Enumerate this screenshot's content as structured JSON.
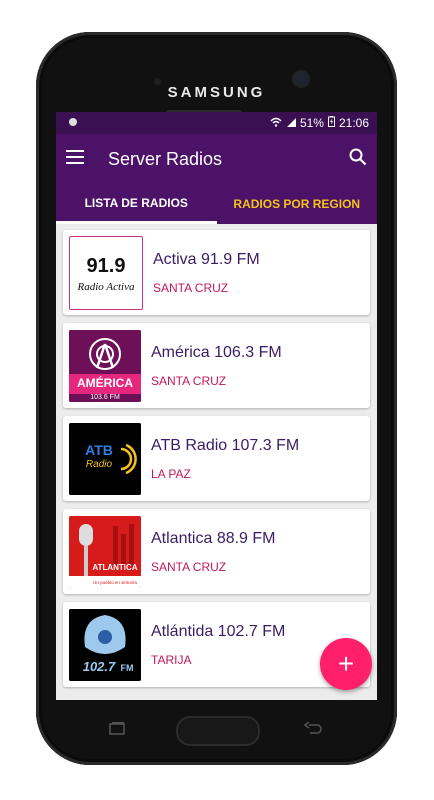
{
  "device": {
    "brand": "SAMSUNG"
  },
  "status": {
    "signal_text": "51%",
    "battery_icon": "battery-charging-icon",
    "time": "21:06"
  },
  "appbar": {
    "title": "Server Radios",
    "menu_icon": "hamburger-icon",
    "search_icon": "search-icon"
  },
  "tabs": [
    {
      "label": "LISTA DE RADIOS",
      "active": true
    },
    {
      "label": "RADIOS POR REGION",
      "active": false
    }
  ],
  "radios": [
    {
      "name": "Activa 91.9 FM",
      "city": "SANTA CRUZ",
      "logo": "activa-logo",
      "logo_text": "91.9",
      "logo_sub": "Radio Activa"
    },
    {
      "name": "América 106.3 FM",
      "city": "SANTA CRUZ",
      "logo": "america-logo",
      "logo_text": "AMÉRICA",
      "logo_sub": "103.6 FM"
    },
    {
      "name": "ATB Radio 107.3 FM",
      "city": "LA PAZ",
      "logo": "atb-logo",
      "logo_text": "ATB",
      "logo_sub": "Radio"
    },
    {
      "name": "Atlantica 88.9 FM",
      "city": "SANTA CRUZ",
      "logo": "atlantica-logo",
      "logo_text": "ATLANTICA",
      "logo_sub": "Un pueblo en sintonía"
    },
    {
      "name": "Atlántida 102.7 FM",
      "city": "TARIJA",
      "logo": "atlantida-logo",
      "logo_text": "102.7",
      "logo_sub": "FM"
    }
  ],
  "fab": {
    "label": "+"
  },
  "colors": {
    "primary": "#4b1267",
    "status": "#3a1052",
    "accent_tab": "#f4c21b",
    "city": "#c2185b",
    "fab": "#ff1f6a"
  }
}
